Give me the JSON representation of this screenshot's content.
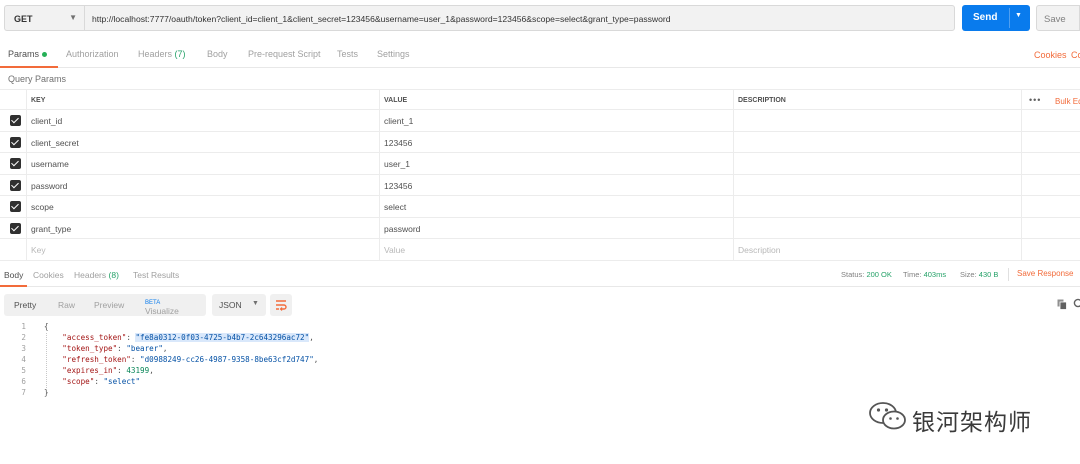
{
  "request": {
    "method": "GET",
    "url": "http://localhost:7777/oauth/token?client_id=client_1&client_secret=123456&username=user_1&password=123456&scope=select&grant_type=password",
    "send_label": "Send",
    "save_label": "Save"
  },
  "request_tabs": {
    "params": "Params",
    "authorization": "Authorization",
    "headers": "Headers",
    "headers_count": "(7)",
    "body": "Body",
    "prerequest": "Pre-request Script",
    "tests": "Tests",
    "settings": "Settings",
    "cookies": "Cookies",
    "code": "Co"
  },
  "query_params": {
    "title": "Query Params",
    "headers": {
      "key": "KEY",
      "value": "VALUE",
      "description": "DESCRIPTION",
      "bulk_edit": "Bulk Ed"
    },
    "rows": [
      {
        "key": "client_id",
        "value": "client_1"
      },
      {
        "key": "client_secret",
        "value": "123456"
      },
      {
        "key": "username",
        "value": "user_1"
      },
      {
        "key": "password",
        "value": "123456"
      },
      {
        "key": "scope",
        "value": "select"
      },
      {
        "key": "grant_type",
        "value": "password"
      }
    ],
    "placeholder": {
      "key": "Key",
      "value": "Value",
      "description": "Description"
    }
  },
  "response_tabs": {
    "body": "Body",
    "cookies": "Cookies",
    "headers": "Headers",
    "headers_count": "(8)",
    "test_results": "Test Results",
    "status_label": "Status:",
    "status_value": "200 OK",
    "time_label": "Time:",
    "time_value": "403ms",
    "size_label": "Size:",
    "size_value": "430 B",
    "save_response": "Save Response"
  },
  "body_toolbar": {
    "pretty": "Pretty",
    "raw": "Raw",
    "preview": "Preview",
    "visualize": "Visualize",
    "beta": "BETA",
    "format": "JSON"
  },
  "response_body": {
    "line_numbers": [
      "1",
      "2",
      "3",
      "4",
      "5",
      "6",
      "7"
    ],
    "access_token_key": "\"access_token\"",
    "access_token_value": "\"fe8a0312-0f03-4725-b4b7-2c643296ac72\"",
    "token_type_key": "\"token_type\"",
    "token_type_value": "\"bearer\"",
    "refresh_token_key": "\"refresh_token\"",
    "refresh_token_value": "\"d0988249-cc26-4987-9358-8be63cf2d747\"",
    "expires_in_key": "\"expires_in\"",
    "expires_in_value": "43199",
    "scope_key": "\"scope\"",
    "scope_value": "\"select\""
  },
  "watermark": {
    "text": "银河架构师"
  },
  "colors": {
    "accent": "#f26b3a",
    "send": "#097bed",
    "status_ok": "#26a269"
  }
}
